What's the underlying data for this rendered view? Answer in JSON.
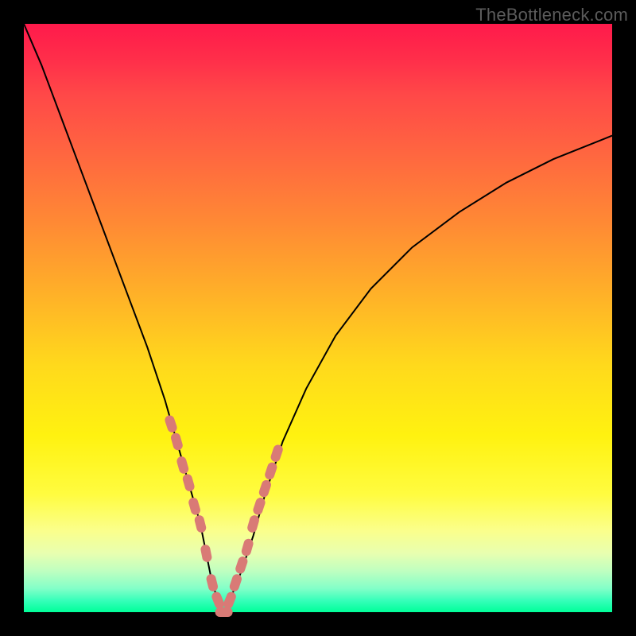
{
  "watermark": "TheBottleneck.com",
  "colors": {
    "frame": "#000000",
    "marker": "#d97a76",
    "curve": "#000000",
    "gradient_top": "#ff1a4b",
    "gradient_bottom": "#00ff99"
  },
  "chart_data": {
    "type": "line",
    "title": "",
    "xlabel": "",
    "ylabel": "",
    "xlim": [
      0,
      100
    ],
    "ylim": [
      0,
      100
    ],
    "series": [
      {
        "name": "bottleneck-curve",
        "x": [
          0,
          3,
          6,
          9,
          12,
          15,
          18,
          21,
          24,
          26,
          28,
          30,
          31,
          32,
          33,
          34,
          35,
          37,
          39,
          41,
          44,
          48,
          53,
          59,
          66,
          74,
          82,
          90,
          100
        ],
        "values": [
          100,
          93,
          85,
          77,
          69,
          61,
          53,
          45,
          36,
          29,
          22,
          15,
          10,
          5,
          2,
          0,
          2,
          7,
          13,
          20,
          29,
          38,
          47,
          55,
          62,
          68,
          73,
          77,
          81
        ]
      }
    ],
    "markers": {
      "name": "highlight-band",
      "x": [
        25,
        26,
        27,
        28,
        29,
        30,
        31,
        32,
        33,
        34,
        35,
        36,
        37,
        38,
        39,
        40,
        41,
        42,
        43
      ],
      "values": [
        32,
        29,
        25,
        22,
        18,
        15,
        10,
        5,
        2,
        0,
        2,
        5,
        8,
        11,
        15,
        18,
        21,
        24,
        27
      ]
    }
  }
}
